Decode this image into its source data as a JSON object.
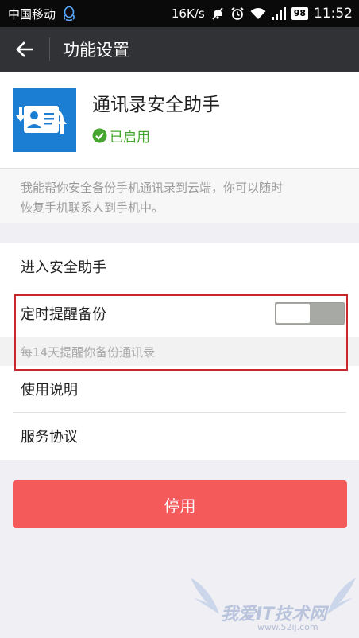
{
  "status_bar": {
    "carrier": "中国移动",
    "speed": "16K/s",
    "battery": "98",
    "time": "11:52",
    "icons": [
      "qq-icon",
      "no-sound-icon",
      "alarm-icon",
      "wifi-icon",
      "signal-icon",
      "battery-icon"
    ]
  },
  "header": {
    "title": "功能设置",
    "back_icon": "arrow-left-icon"
  },
  "app": {
    "name": "通讯录安全助手",
    "status": "已启用",
    "icon": "contacts-sync-icon",
    "icon_color": "#1b7ed3",
    "status_color": "#46a52e"
  },
  "description": {
    "line1": "我能帮你安全备份手机通讯录到云端，你可以随时",
    "line2": "恢复手机联系人到手机中。"
  },
  "menu": {
    "enter": "进入安全助手",
    "reminder": "定时提醒备份",
    "reminder_hint": "每14天提醒你备份通讯录",
    "reminder_enabled": false,
    "instructions": "使用说明",
    "agreement": "服务协议"
  },
  "actions": {
    "disable": "停用",
    "disable_color": "#f45a5a"
  },
  "watermark": {
    "title": "我爱IT技术网",
    "url": "www.52ij.com"
  }
}
